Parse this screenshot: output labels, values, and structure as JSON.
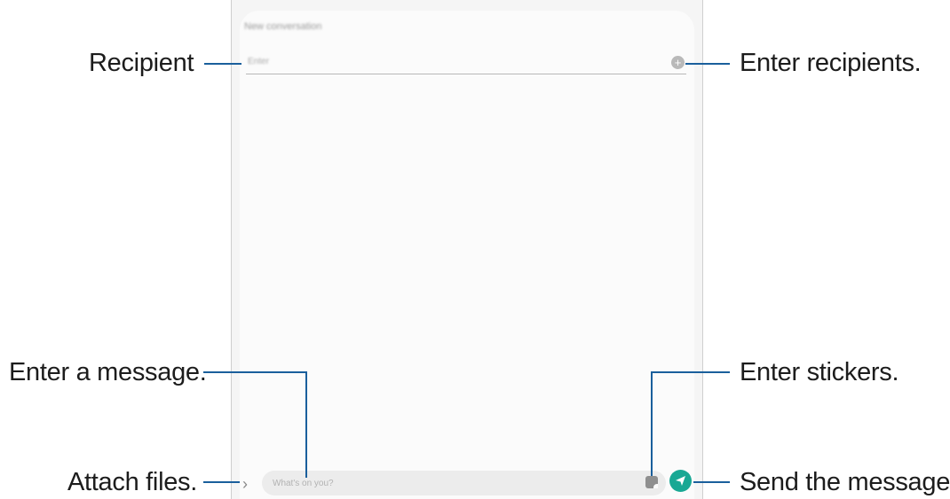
{
  "screen": {
    "conversation_title": "New conversation",
    "recipient_placeholder": "Enter",
    "add_recipient_symbol": "+",
    "attach_symbol": "›",
    "message_placeholder": "What's on you?",
    "icons": {
      "add_recipient": "add-circle-icon",
      "attach": "chevron-right-icon",
      "sticker": "sticker-icon",
      "send": "send-icon"
    },
    "colors": {
      "send_button": "#19a894",
      "callout_line": "#1a5f9c"
    }
  },
  "callouts": {
    "recipient": "Recipient",
    "enter_recipients": "Enter recipients.",
    "enter_message": "Enter a message.",
    "enter_stickers": "Enter stickers.",
    "attach_files": "Attach files.",
    "send_message": "Send the message."
  }
}
